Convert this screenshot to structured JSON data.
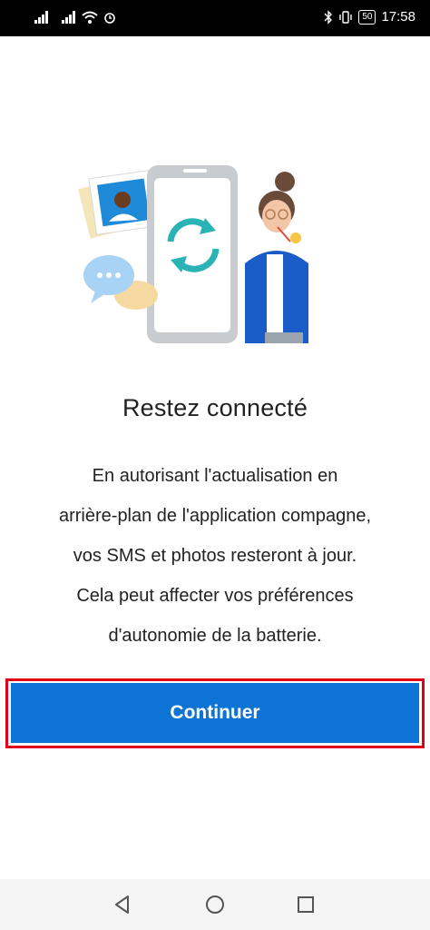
{
  "status_bar": {
    "battery": "50",
    "time": "17:58",
    "icons": [
      "signal-icon",
      "signal-icon",
      "wifi-icon",
      "alarm-icon",
      "bluetooth-icon",
      "vibrate-icon",
      "battery-icon"
    ]
  },
  "illustration": {
    "icons": [
      "phone-icon",
      "sync-icon",
      "photo-icon",
      "chat-bubble-icon",
      "person-icon"
    ]
  },
  "content": {
    "title": "Restez connecté",
    "body_lines": [
      "En autorisant l'actualisation en",
      "arrière-plan de l'application compagne,",
      "vos SMS et photos resteront à jour.",
      "Cela peut affecter vos préférences",
      "d'autonomie de la batterie."
    ]
  },
  "actions": {
    "continue_label": "Continuer"
  },
  "colors": {
    "primary_button": "#0d74d5",
    "highlight_border": "#e0001a",
    "sync_teal": "#2ab3b5"
  },
  "nav_bar": {
    "icons": [
      "back-icon",
      "home-icon",
      "recents-icon"
    ]
  }
}
